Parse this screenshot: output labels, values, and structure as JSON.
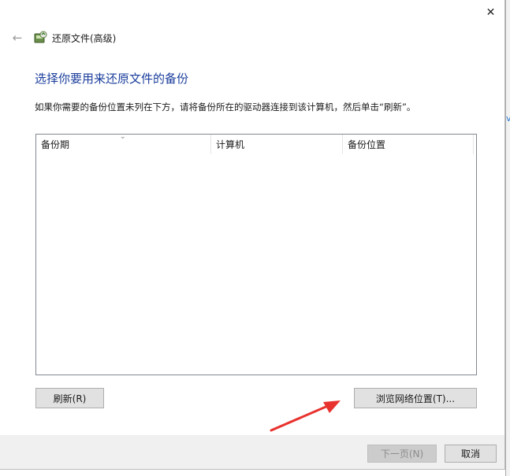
{
  "window": {
    "close_glyph": "✕",
    "back_glyph": "←",
    "title": "还原文件(高级)"
  },
  "main": {
    "heading": "选择你要用来还原文件的备份",
    "instruction": "如果你需要的备份位置未列在下方，请将备份所在的驱动器连接到该计算机，然后单击“刷新”。"
  },
  "list": {
    "columns": [
      "备份期",
      "计算机",
      "备份位置"
    ],
    "sort_glyph": "⌄",
    "rows": []
  },
  "buttons": {
    "refresh": "刷新(R)",
    "browse": "浏览网络位置(T)...",
    "next": "下一页(N)",
    "cancel": "取消"
  },
  "background": {
    "edge_glyph": "v"
  },
  "colors": {
    "heading": "#1a3d9c",
    "annotation_arrow": "#e8322e"
  }
}
